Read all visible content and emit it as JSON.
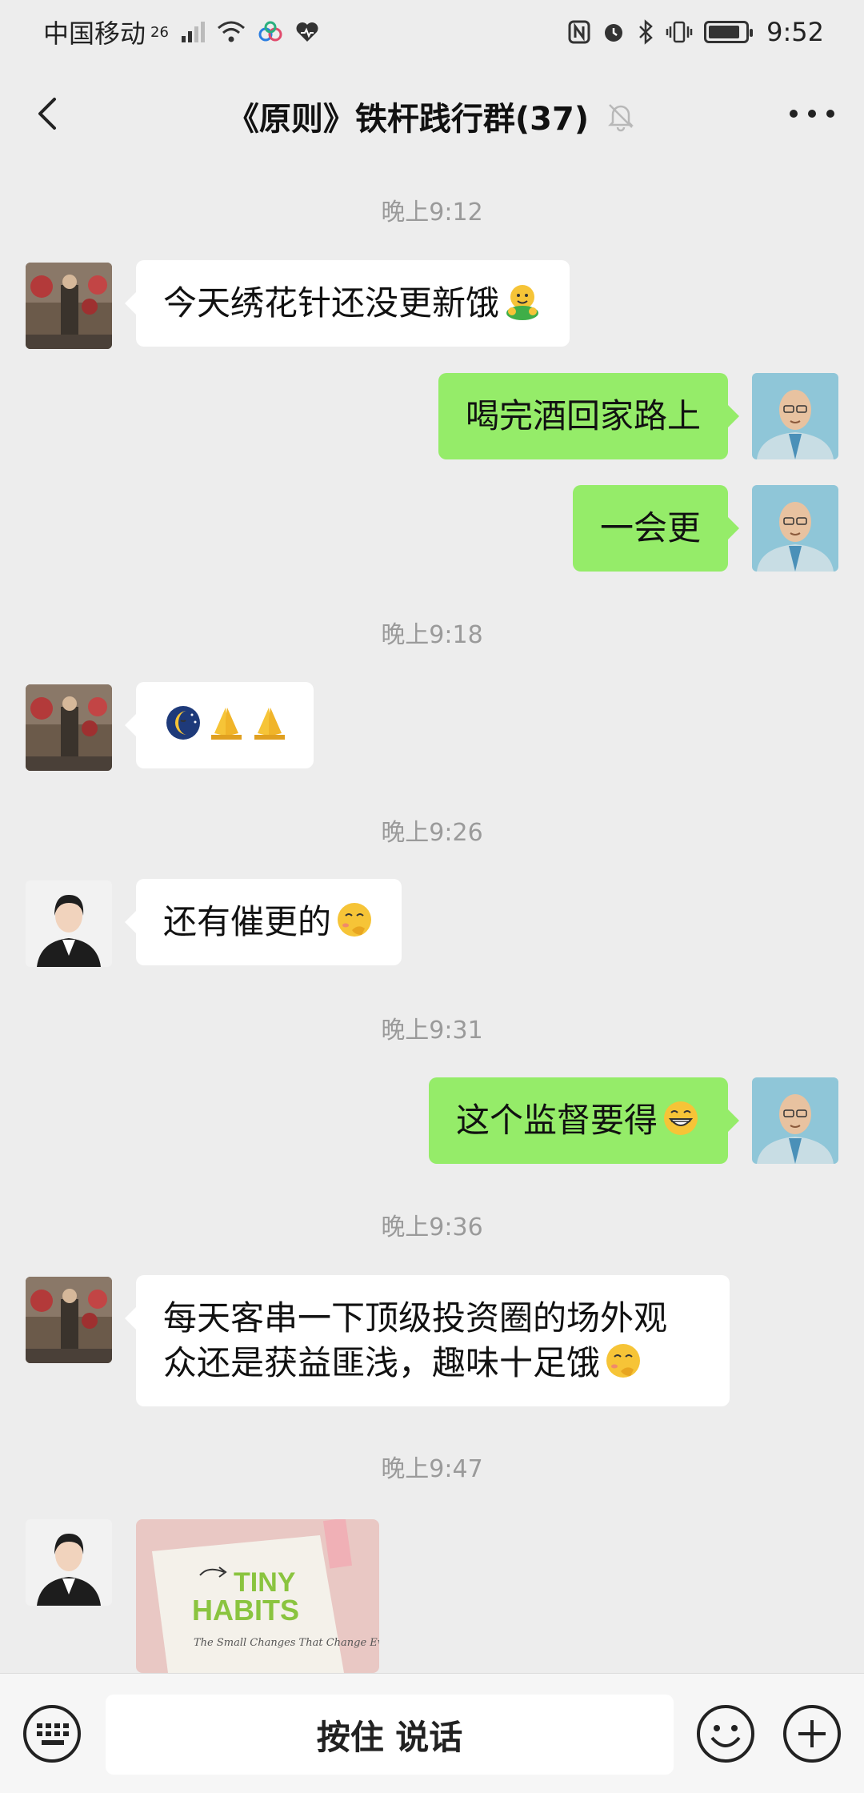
{
  "status_bar": {
    "carrier": "中国移动",
    "network": "26",
    "time": "9:52",
    "battery_level": 0.85
  },
  "header": {
    "title": "《原则》铁杆践行群(37)",
    "icons": [
      "back-arrow-icon",
      "mute-bell-icon",
      "more-icon"
    ]
  },
  "messages": [
    {
      "type": "timestamp",
      "text": "晚上9:12"
    },
    {
      "type": "text",
      "side": "in",
      "sender": "user-a",
      "text": "今天绣花针还没更新饿",
      "emoji": "hug-face"
    },
    {
      "type": "text",
      "side": "out",
      "sender": "me",
      "text": "喝完酒回家路上"
    },
    {
      "type": "text",
      "side": "out",
      "sender": "me",
      "text": "一会更"
    },
    {
      "type": "timestamp",
      "text": "晚上9:18"
    },
    {
      "type": "emoji",
      "side": "in",
      "sender": "user-a",
      "emojis": [
        "moon-face",
        "pray-hands",
        "pray-hands"
      ]
    },
    {
      "type": "timestamp",
      "text": "晚上9:26"
    },
    {
      "type": "text",
      "side": "in",
      "sender": "user-b",
      "text": "还有催更的",
      "emoji": "shy-face"
    },
    {
      "type": "timestamp",
      "text": "晚上9:31"
    },
    {
      "type": "text",
      "side": "out",
      "sender": "me",
      "text": "这个监督要得",
      "emoji": "grin-face"
    },
    {
      "type": "timestamp",
      "text": "晚上9:36"
    },
    {
      "type": "text",
      "side": "in",
      "sender": "user-a",
      "lines": [
        "每天客串一下顶级投资圈的场外观",
        "众还是获益匪浅，趣味十足饿"
      ],
      "emoji": "shy-face"
    },
    {
      "type": "timestamp",
      "text": "晚上9:47"
    },
    {
      "type": "image",
      "side": "in",
      "sender": "user-b",
      "book": {
        "title_line1": "TINY",
        "title_line2": "HABITS",
        "subtitle": "The Small Changes That Change Everything"
      }
    }
  ],
  "input_bar": {
    "voice_label": "按住 说话",
    "icons": [
      "keyboard-icon",
      "emoji-icon",
      "plus-icon"
    ]
  },
  "colors": {
    "background": "#ededed",
    "outgoing_bubble": "#95ec69",
    "incoming_bubble": "#ffffff",
    "timestamp": "#9a9a9a"
  }
}
